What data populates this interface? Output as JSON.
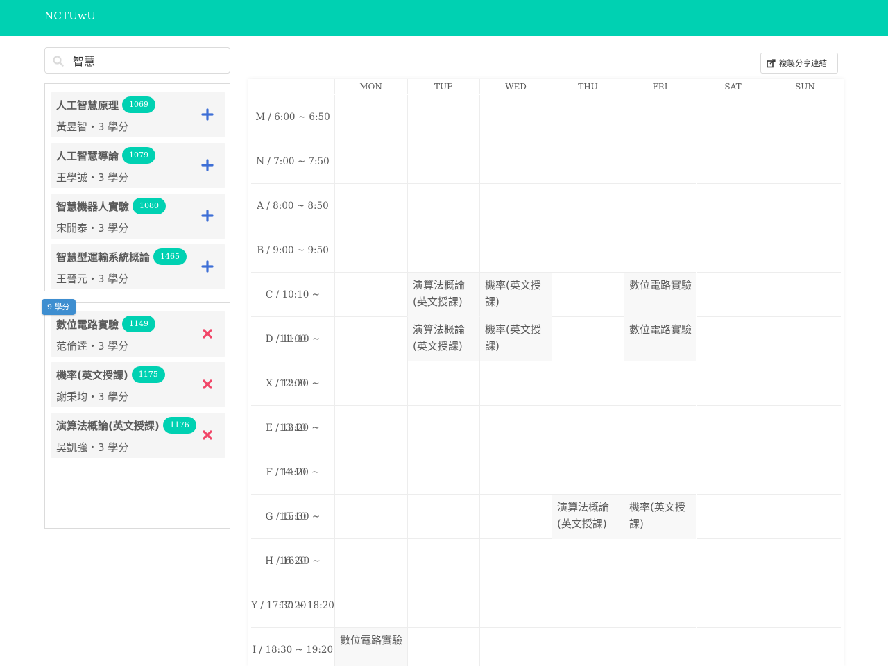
{
  "navbar": {
    "brand": "NCTUwU",
    "bg": "#00d1b2"
  },
  "search": {
    "value": "智慧",
    "placeholder": "",
    "icon": "search-icon"
  },
  "results": [
    {
      "title": "人工智慧原理",
      "tag": "1069",
      "teacher": "黃昱智",
      "credits": "3 學分",
      "sub": "黃昱智・3 學分"
    },
    {
      "title": "人工智慧導論",
      "tag": "1079",
      "teacher": "王學誠",
      "credits": "3 學分",
      "sub": "王學誠・3 學分"
    },
    {
      "title": "智慧機器人實驗",
      "tag": "1080",
      "teacher": "宋開泰",
      "credits": "3 學分",
      "sub": "宋開泰・3 學分"
    },
    {
      "title": "智慧型運輸系統概論",
      "tag": "1465",
      "teacher": "王晉元",
      "credits": "3 學分",
      "sub": "王晉元・3 學分"
    }
  ],
  "selected": {
    "total_badge": "9 學分",
    "items": [
      {
        "title": "數位電路實驗",
        "tag": "1149",
        "sub": "范倫達・3 學分"
      },
      {
        "title": "機率(英文授課)",
        "tag": "1175",
        "sub": "謝秉均・3 學分"
      },
      {
        "title": "演算法概論(英文授課)",
        "tag": "1176",
        "sub": "吳凱強・3 學分"
      }
    ]
  },
  "share_button": {
    "label": "複製分享連結",
    "icon": "share-icon"
  },
  "timetable": {
    "days": [
      "MON",
      "TUE",
      "WED",
      "THU",
      "FRI",
      "SAT",
      "SUN"
    ],
    "periods": [
      "M / 6:00 ~ 6:50",
      "N / 7:00 ~ 7:50",
      "A / 8:00 ~ 8:50",
      "B / 9:00 ~ 9:50",
      "C / 10:10 ~ 11:00",
      "D / 11:10 ~ 12:00",
      "X / 12:20 ~ 13:10",
      "E / 13:20 ~ 14:10",
      "F / 14:20 ~ 15:10",
      "G / 15:30 ~ 16:20",
      "H / 16:30 ~ 17:20",
      "Y / 17:30 ~ 18:20",
      "I / 18:30 ~ 19:20"
    ],
    "events": [
      {
        "day": 1,
        "period": 4,
        "label": "演算法概論(英文授課)"
      },
      {
        "day": 1,
        "period": 5,
        "label": "演算法概論(英文授課)"
      },
      {
        "day": 2,
        "period": 4,
        "label": "機率(英文授課)"
      },
      {
        "day": 2,
        "period": 5,
        "label": "機率(英文授課)"
      },
      {
        "day": 4,
        "period": 4,
        "label": "數位電路實驗"
      },
      {
        "day": 4,
        "period": 5,
        "label": "數位電路實驗"
      },
      {
        "day": 3,
        "period": 9,
        "label": "演算法概論(英文授課)"
      },
      {
        "day": 4,
        "period": 9,
        "label": "機率(英文授課)"
      },
      {
        "day": 0,
        "period": 12,
        "label": "數位電路實驗"
      }
    ]
  },
  "colors": {
    "accent": "#00d1b2",
    "add": "#3e6fd6",
    "remove": "#f14668",
    "badge": "#3e8ed0"
  }
}
